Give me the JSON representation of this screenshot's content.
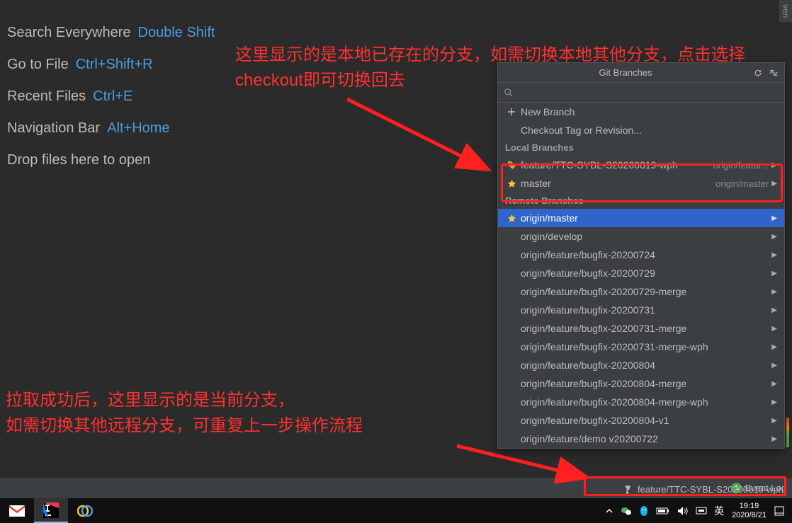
{
  "hints": {
    "search": {
      "label": "Search Everywhere",
      "shortcut": "Double Shift"
    },
    "gotofile": {
      "label": "Go to File",
      "shortcut": "Ctrl+Shift+R"
    },
    "recent": {
      "label": "Recent Files",
      "shortcut": "Ctrl+E"
    },
    "navbar": {
      "label": "Navigation Bar",
      "shortcut": "Alt+Home"
    },
    "drop": {
      "label": "Drop files here to open"
    }
  },
  "annotations": {
    "top": "这里显示的是本地已存在的分支，如需切换本地其他分支，点击选择checkout即可切换回去",
    "bottom": "拉取成功后，这里显示的是当前分支，\n如需切换其他远程分支，可重复上一步操作流程"
  },
  "popup": {
    "title": "Git Branches",
    "actions": {
      "new_branch": "New Branch",
      "checkout_tag": "Checkout Tag or Revision..."
    },
    "sections": {
      "local": "Local Branches",
      "remote": "Remote Branches"
    },
    "local_branches": [
      {
        "name": "feature/TTC-SYBL-S20200819-wph",
        "tracking": "origin/featur...",
        "icon": "tag"
      },
      {
        "name": "master",
        "tracking": "origin/master",
        "icon": "star"
      }
    ],
    "remote_branches": [
      {
        "name": "origin/master",
        "icon": "star",
        "selected": true
      },
      {
        "name": "origin/develop"
      },
      {
        "name": "origin/feature/bugfix-20200724"
      },
      {
        "name": "origin/feature/bugfix-20200729"
      },
      {
        "name": "origin/feature/bugfix-20200729-merge"
      },
      {
        "name": "origin/feature/bugfix-20200731"
      },
      {
        "name": "origin/feature/bugfix-20200731-merge"
      },
      {
        "name": "origin/feature/bugfix-20200731-merge-wph"
      },
      {
        "name": "origin/feature/bugfix-20200804"
      },
      {
        "name": "origin/feature/bugfix-20200804-merge"
      },
      {
        "name": "origin/feature/bugfix-20200804-merge-wph"
      },
      {
        "name": "origin/feature/bugfix-20200804-v1"
      },
      {
        "name": "origin/feature/demo v20200722"
      }
    ]
  },
  "status": {
    "event_log": "Event Log",
    "event_count": "1",
    "current_branch": "feature/TTC-SYBL-S20200819-wph"
  },
  "tray": {
    "ime": "英",
    "time": "19:19",
    "date": "2020/8/21"
  },
  "maven_tab": "ven"
}
